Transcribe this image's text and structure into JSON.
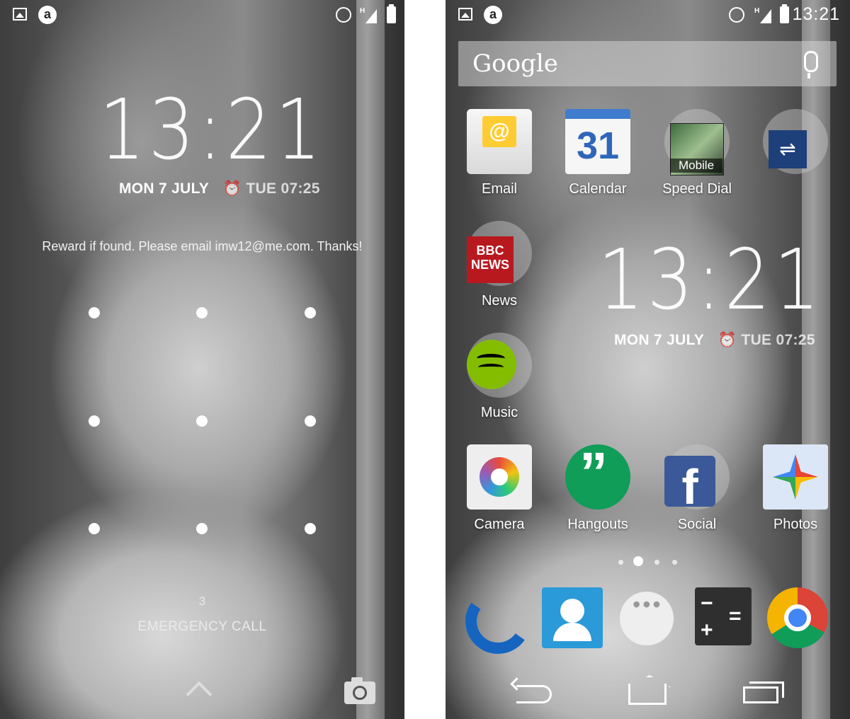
{
  "lock_screen": {
    "status_icons": [
      "picture-icon",
      "circle-a-icon",
      "alarm-icon",
      "signal-h-icon",
      "battery-icon"
    ],
    "clock": "13:21",
    "date": "MON 7 JULY",
    "alarm": "TUE 07:25",
    "owner_info": "Reward if found. Please email imw12@me.com. Thanks!",
    "pattern_hint": "3",
    "emergency_call": "EMERGENCY CALL"
  },
  "home_screen": {
    "status_time": "13:21",
    "search_brand": "Google",
    "clock": "13:21",
    "date": "MON 7 JULY",
    "alarm": "TUE 07:25",
    "apps": {
      "email": "Email",
      "calendar": "Calendar",
      "calendar_day": "31",
      "speed_dial": "Speed Dial",
      "speed_dial_badge": "Mobile",
      "news": "News",
      "news_badge": "BBC NEWS",
      "music": "Music",
      "camera": "Camera",
      "hangouts": "Hangouts",
      "social": "Social",
      "photos": "Photos"
    },
    "dock": [
      "phone",
      "contacts",
      "apps",
      "calculator",
      "chrome"
    ],
    "page_indicator": {
      "count": 4,
      "active": 1
    }
  }
}
